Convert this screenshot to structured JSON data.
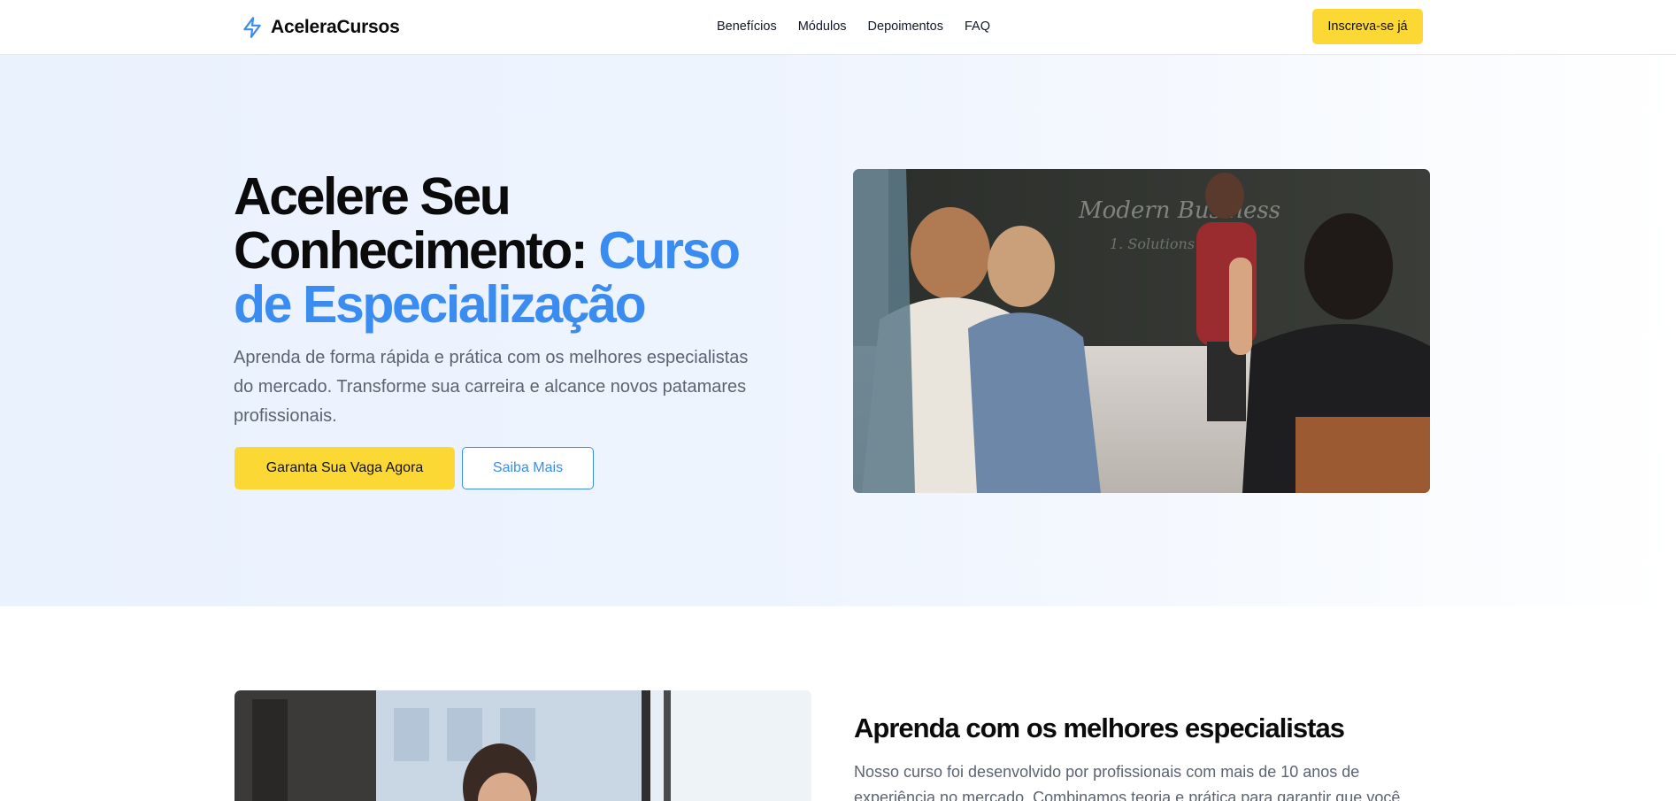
{
  "header": {
    "brand": "AceleraCursos",
    "nav": [
      "Benefícios",
      "Módulos",
      "Depoimentos",
      "FAQ"
    ],
    "cta": "Inscreva-se já"
  },
  "hero": {
    "title_line1": "Acelere Seu",
    "title_line2": "Conhecimento: ",
    "title_accent_1": "Curso",
    "title_accent_2": "de Especialização",
    "subtitle": "Aprenda de forma rápida e prática com os melhores especialistas do mercado. Transforme sua carreira e alcance novos patamares profissionais.",
    "primary_button": "Garanta Sua Vaga Agora",
    "secondary_button": "Saiba Mais",
    "image_icon": "classroom-photo"
  },
  "experts": {
    "title": "Aprenda com os melhores especialistas",
    "text": "Nosso curso foi desenvolvido por profissionais com mais de 10 anos de experiência no mercado. Combinamos teoria e prática para garantir que você",
    "image_icon": "student-with-headset-photo"
  },
  "colors": {
    "accent_blue": "#3b8cf0",
    "accent_yellow": "#fcd834",
    "hero_background": "#eaf2fe",
    "body_text": "#5b6472"
  }
}
